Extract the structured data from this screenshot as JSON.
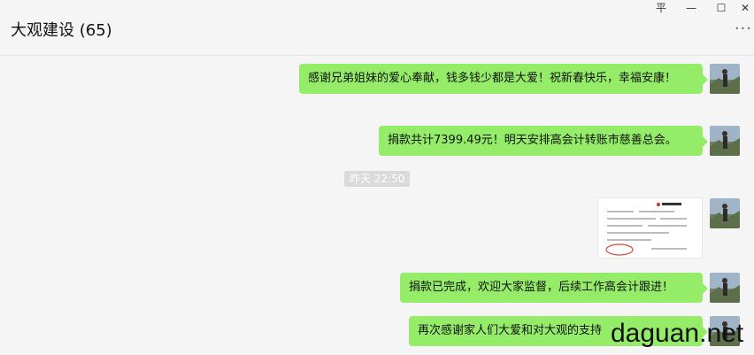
{
  "window": {
    "controls": {
      "pin": "平",
      "minimize": "—",
      "maximize": "☐",
      "close": "✕"
    }
  },
  "header": {
    "title": "大观建设 (65)",
    "more": "···"
  },
  "messages": [
    {
      "type": "text",
      "text": "感谢兄弟姐妹的爱心奉献，钱多钱少都是大爱！祝新春快乐，幸福安康！"
    },
    {
      "type": "text",
      "text": "捐款共计7399.49元！明天安排高会计转账市慈善总会。"
    },
    {
      "type": "timestamp",
      "text": "昨天 22:50"
    },
    {
      "type": "image",
      "alt": "receipt-image"
    },
    {
      "type": "text",
      "text": "捐款已完成，欢迎大家监督，后续工作高会计跟进！"
    },
    {
      "type": "text",
      "text": "再次感谢家人们大爱和对大观的支持"
    }
  ],
  "watermark": {
    "text": "daguan.net"
  },
  "colors": {
    "bubble": "#95ec69",
    "background": "#f5f5f5",
    "timestamp_bg": "#dadada"
  }
}
